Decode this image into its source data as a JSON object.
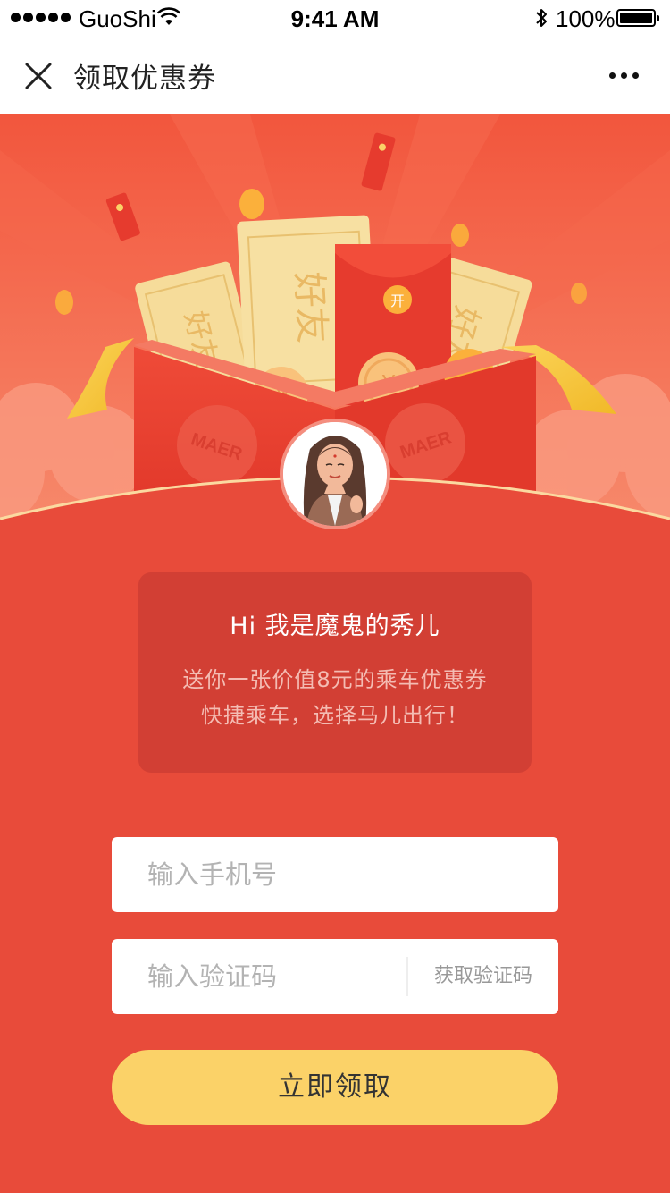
{
  "status_bar": {
    "carrier": "GuoShi",
    "time": "9:41 AM",
    "battery": "100%"
  },
  "nav": {
    "title": "领取优惠券"
  },
  "hero": {
    "ticket_text": "好友",
    "envelope_badge": "开",
    "brand_mark": "MAER",
    "coin_symbol": "¥"
  },
  "message": {
    "greeting": "Hi  我是魔鬼的秀儿",
    "line1": "送你一张价值8元的乘车优惠券",
    "line2": "快捷乘车，选择马儿出行！"
  },
  "form": {
    "phone_placeholder": "输入手机号",
    "code_placeholder": "输入验证码",
    "get_code_label": "获取验证码",
    "submit_label": "立即领取"
  },
  "colors": {
    "background": "#e84b3a",
    "card": "#d23f34",
    "button": "#fbd268",
    "envelope": "#e6382c",
    "ticket": "#f6dc9a"
  }
}
